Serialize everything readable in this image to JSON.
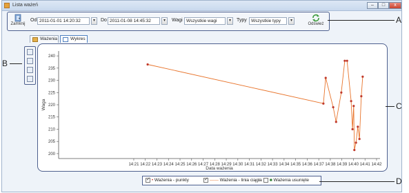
{
  "window": {
    "title": "Lista ważeń",
    "min": "–",
    "max": "□",
    "close": "x"
  },
  "toolbar": {
    "close_label": "Zamknij",
    "from_label": "Od",
    "from_value": "2011-01-01 14:20:32",
    "to_label": "Do",
    "to_value": "2011-01-08 14:45:32",
    "scale_label": "Wagi",
    "scale_value": "Wszystkie wagi",
    "types_label": "Typy",
    "types_value": "Wszystkie typy",
    "refresh_label": "Odśwież"
  },
  "tabs": [
    {
      "label": "Ważenia"
    },
    {
      "label": "Wykres"
    }
  ],
  "legend": [
    {
      "label": "Ważenia - punkty",
      "checked": true
    },
    {
      "label": "Ważenia - linia ciągła",
      "checked": true
    },
    {
      "label": "Ważenia usunięte",
      "checked": false
    }
  ],
  "callouts": {
    "a": "A",
    "b": "B",
    "c": "C",
    "d": "D"
  },
  "icons": {
    "close": "door-exit-icon",
    "refresh": "refresh-arrows-icon",
    "calendar": "calendar-icon"
  },
  "colors": {
    "accent": "#4d5f8e",
    "series_line": "#e8732a",
    "points": "#c0392b"
  },
  "chart_data": {
    "type": "line",
    "xlabel": "Data ważenia",
    "ylabel": "Waga",
    "ylim": [
      198,
      242
    ],
    "yticks": [
      200,
      205,
      210,
      215,
      220,
      225,
      230,
      235,
      240
    ],
    "xlim": [
      14.5,
      42.3
    ],
    "xticks": [
      {
        "v": 21,
        "label": "14:21"
      },
      {
        "v": 22,
        "label": "14:22"
      },
      {
        "v": 23,
        "label": "14:23"
      },
      {
        "v": 24,
        "label": "14:24"
      },
      {
        "v": 25,
        "label": "14:25"
      },
      {
        "v": 26,
        "label": "14:26"
      },
      {
        "v": 27,
        "label": "14:27"
      },
      {
        "v": 28,
        "label": "14:28"
      },
      {
        "v": 29,
        "label": "14:29"
      },
      {
        "v": 30,
        "label": "14:30"
      },
      {
        "v": 31,
        "label": "14:31"
      },
      {
        "v": 32,
        "label": "14:32"
      },
      {
        "v": 33,
        "label": "14:33"
      },
      {
        "v": 34,
        "label": "14:34"
      },
      {
        "v": 35,
        "label": "14:35"
      },
      {
        "v": 36,
        "label": "14:36"
      },
      {
        "v": 37,
        "label": "14:37"
      },
      {
        "v": 38,
        "label": "14:38"
      },
      {
        "v": 39,
        "label": "14:39"
      },
      {
        "v": 40,
        "label": "14:40"
      },
      {
        "v": 41,
        "label": "14:41"
      },
      {
        "v": 42,
        "label": "14:42"
      }
    ],
    "grid": false,
    "series": [
      {
        "name": "Ważenia - linia ciągła",
        "points": [
          [
            22.2,
            236.5
          ],
          [
            37.4,
            220.5
          ],
          [
            37.6,
            231
          ],
          [
            38.25,
            219
          ],
          [
            38.5,
            213
          ],
          [
            38.95,
            225
          ],
          [
            39.25,
            238
          ],
          [
            39.45,
            238
          ],
          [
            39.8,
            221.5
          ],
          [
            39.92,
            210
          ],
          [
            40.02,
            219.5
          ],
          [
            40.08,
            201.5
          ],
          [
            40.22,
            204.5
          ],
          [
            40.38,
            211
          ],
          [
            40.52,
            206
          ],
          [
            40.68,
            223.5
          ],
          [
            40.8,
            231.5
          ]
        ]
      }
    ]
  }
}
